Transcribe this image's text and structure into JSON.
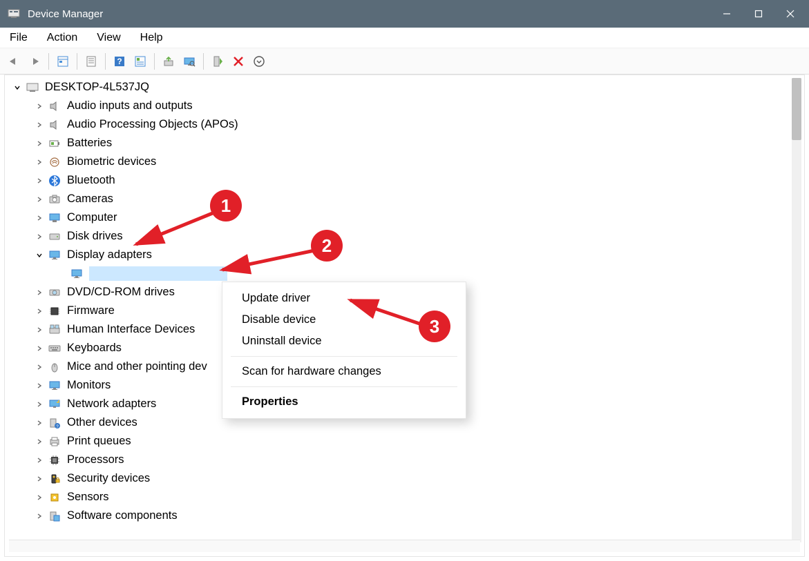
{
  "window": {
    "title": "Device Manager"
  },
  "menu": {
    "file": "File",
    "action": "Action",
    "view": "View",
    "help": "Help"
  },
  "toolbar": {
    "back": "Back",
    "forward": "Forward",
    "show_hidden": "Show hidden devices",
    "properties": "Properties",
    "help": "Help",
    "details": "Details",
    "update": "Update driver",
    "scan": "Scan for hardware changes",
    "enable": "Enable device",
    "uninstall": "Uninstall device",
    "collapse": "Collapse"
  },
  "tree": {
    "root": "DESKTOP-4L537JQ",
    "categories": [
      {
        "label": "Audio inputs and outputs",
        "icon": "speaker"
      },
      {
        "label": "Audio Processing Objects (APOs)",
        "icon": "speaker"
      },
      {
        "label": "Batteries",
        "icon": "battery"
      },
      {
        "label": "Biometric devices",
        "icon": "fingerprint"
      },
      {
        "label": "Bluetooth",
        "icon": "bluetooth"
      },
      {
        "label": "Cameras",
        "icon": "camera"
      },
      {
        "label": "Computer",
        "icon": "computer"
      },
      {
        "label": "Disk drives",
        "icon": "disk"
      },
      {
        "label": "Display adapters",
        "icon": "display",
        "expanded": true,
        "children": [
          {
            "label": "",
            "icon": "display",
            "selected": true
          }
        ]
      },
      {
        "label": "DVD/CD-ROM drives",
        "icon": "cdrom"
      },
      {
        "label": "Firmware",
        "icon": "chip"
      },
      {
        "label": "Human Interface Devices",
        "icon": "hid"
      },
      {
        "label": "Keyboards",
        "icon": "keyboard"
      },
      {
        "label": "Mice and other pointing devices",
        "icon": "mouse",
        "truncated": "Mice and other pointing dev"
      },
      {
        "label": "Monitors",
        "icon": "monitor"
      },
      {
        "label": "Network adapters",
        "icon": "network"
      },
      {
        "label": "Other devices",
        "icon": "other"
      },
      {
        "label": "Print queues",
        "icon": "printer"
      },
      {
        "label": "Processors",
        "icon": "cpu"
      },
      {
        "label": "Security devices",
        "icon": "security"
      },
      {
        "label": "Sensors",
        "icon": "sensor"
      },
      {
        "label": "Software components",
        "icon": "software"
      }
    ]
  },
  "context_menu": {
    "update": "Update driver",
    "disable": "Disable device",
    "uninstall": "Uninstall device",
    "scan": "Scan for hardware changes",
    "properties": "Properties"
  },
  "annotations": {
    "step1": "1",
    "step2": "2",
    "step3": "3"
  }
}
